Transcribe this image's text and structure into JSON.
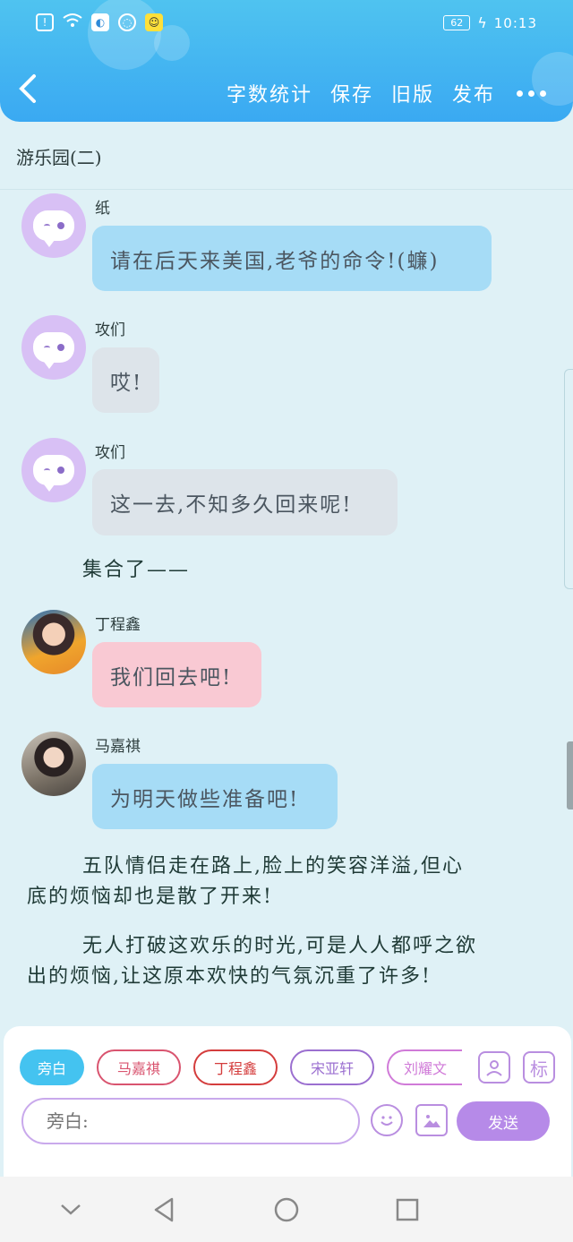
{
  "status_bar": {
    "battery": "62",
    "time": "10:13",
    "icons": [
      "alert-icon",
      "wifi-icon",
      "app-icon",
      "browser-icon",
      "emoji-app-icon"
    ]
  },
  "header": {
    "back_icon": "chevron-left-icon",
    "actions": [
      "字数统计",
      "保存",
      "旧版",
      "发布"
    ],
    "more_icon": "more-dots-icon"
  },
  "chapter": {
    "title": "游乐园(二)"
  },
  "messages": [
    {
      "speaker": "纸",
      "text": "请在后天来美国,老爷的命令!(蠊)",
      "avatar": "default-avatar",
      "color": "blue"
    },
    {
      "speaker": "攻们",
      "text": "哎!",
      "avatar": "default-avatar",
      "color": "gray"
    },
    {
      "speaker": "攻们",
      "text": "这一去,不知多久回来呢!",
      "avatar": "default-avatar",
      "color": "gray"
    },
    {
      "speaker": "丁程鑫",
      "text": "我们回去吧!",
      "avatar": "photo-avatar",
      "color": "pink"
    },
    {
      "speaker": "马嘉祺",
      "text": "为明天做些准备吧!",
      "avatar": "photo-avatar",
      "color": "blue"
    }
  ],
  "narration": {
    "gather": "集合了——",
    "paragraph1_line1": "五队情侣走在路上,脸上的笑容洋溢,但心",
    "paragraph1_line2": "底的烦恼却也是散了开来!",
    "paragraph2_line1": "无人打破这欢乐的时光,可是人人都呼之欲",
    "paragraph2_line2": "出的烦恼,让这原本欢快的气氛沉重了许多!"
  },
  "roles": [
    "旁白",
    "马嘉祺",
    "丁程鑫",
    "宋亚轩",
    "刘耀文"
  ],
  "role_colors": {
    "active": "#44c3f0",
    "马嘉祺": "#d9546f",
    "丁程鑫": "#d43d3d",
    "宋亚轩": "#9b6fd0",
    "刘耀文": "#d07ad8"
  },
  "input": {
    "placeholder": "旁白:",
    "send_label": "发送",
    "tag_label": "标",
    "icons": [
      "contact-card-icon",
      "tag-icon",
      "emoji-icon",
      "image-icon"
    ]
  },
  "system_nav": [
    "chevron-down-icon",
    "back-triangle-icon",
    "home-circle-icon",
    "recents-square-icon"
  ],
  "colors": {
    "header": "#3aa9f2",
    "background": "#dff1f6",
    "bubble_blue": "#a6dcf6",
    "bubble_gray": "#dde4ea",
    "bubble_pink": "#f9c9d3",
    "send": "#b68ae8"
  }
}
